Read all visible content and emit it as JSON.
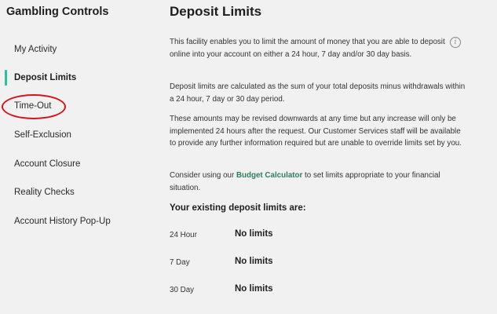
{
  "sidebar": {
    "title": "Gambling Controls",
    "items": [
      {
        "label": "My Activity"
      },
      {
        "label": "Deposit Limits"
      },
      {
        "label": "Time-Out"
      },
      {
        "label": "Self-Exclusion"
      },
      {
        "label": "Account Closure"
      },
      {
        "label": "Reality Checks"
      },
      {
        "label": "Account History Pop-Up"
      }
    ],
    "active_item": "Deposit Limits",
    "highlight_color": "#2fbf9f",
    "annotation_color": "#d3141c"
  },
  "main": {
    "title": "Deposit Limits",
    "info_icon": "info-circle-icon",
    "paragraphs": [
      "This facility enables you to limit the amount of money that you are able to deposit online into your account on either a 24 hour, 7 day and/or 30 day basis.",
      "Deposit limits are calculated as the sum of your total deposits minus withdrawals within a 24 hour, 7 day or 30 day period.",
      "These amounts may be revised downwards at any time but any increase will only be implemented 24 hours after the request. Our Customer Services staff will be available to provide any further information required but are unable to override limits set by you."
    ],
    "budget_text_before": "Consider using our ",
    "budget_link": "Budget Calculator",
    "budget_text_after": " to set limits appropriate to your financial situation.",
    "link_color": "#2e7d5b",
    "limits_heading": "Your existing deposit limits are:",
    "limits": [
      {
        "period": "24 Hour",
        "value": "No limits"
      },
      {
        "period": "7 Day",
        "value": "No limits"
      },
      {
        "period": "30 Day",
        "value": "No limits"
      }
    ]
  }
}
